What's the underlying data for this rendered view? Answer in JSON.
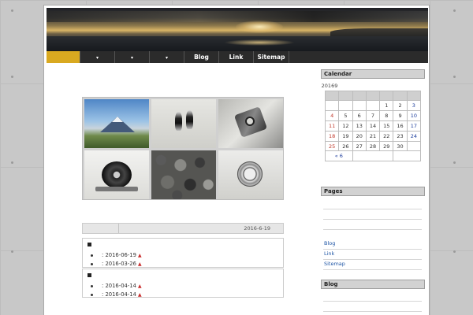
{
  "nav": {
    "items": [
      {
        "label": "",
        "caret": "",
        "active": true
      },
      {
        "label": "",
        "caret": "▾",
        "active": false
      },
      {
        "label": "",
        "caret": "▾",
        "active": false
      },
      {
        "label": "",
        "caret": "▾",
        "active": false
      },
      {
        "label": "Blog",
        "caret": "",
        "active": false
      },
      {
        "label": "Link",
        "caret": "",
        "active": false
      },
      {
        "label": "Sitemap",
        "caret": "",
        "active": false
      }
    ]
  },
  "colors": {
    "nav_bg": "#2b2b2b",
    "nav_active": "#d9a920",
    "link": "#1f56a6"
  },
  "post": {
    "date": "2016-6-19"
  },
  "lists": [
    {
      "items": [
        {
          "text": ": 2016-06-19"
        },
        {
          "text": ": 2016-03-26"
        }
      ]
    },
    {
      "items": [
        {
          "text": ": 2016-04-14"
        },
        {
          "text": ": 2016-04-14"
        }
      ]
    }
  ],
  "sidebar": {
    "calendar": {
      "title": "Calendar",
      "caption": "20169",
      "headers": [
        "",
        "",
        "",
        "",
        "",
        "",
        ""
      ],
      "weeks": [
        [
          "",
          "",
          "",
          "",
          "1",
          "2",
          "3"
        ],
        [
          "4",
          "5",
          "6",
          "7",
          "8",
          "9",
          "10"
        ],
        [
          "11",
          "12",
          "13",
          "14",
          "15",
          "16",
          "17"
        ],
        [
          "18",
          "19",
          "20",
          "21",
          "22",
          "23",
          "24"
        ],
        [
          "25",
          "26",
          "27",
          "28",
          "29",
          "30",
          ""
        ]
      ],
      "prev": "« 6"
    },
    "pages": {
      "title": "Pages",
      "links": [
        "Blog",
        "Link",
        "Sitemap"
      ]
    },
    "blog": {
      "title": "Blog"
    }
  },
  "icons": {
    "new_badge": "new-badge-icon"
  }
}
